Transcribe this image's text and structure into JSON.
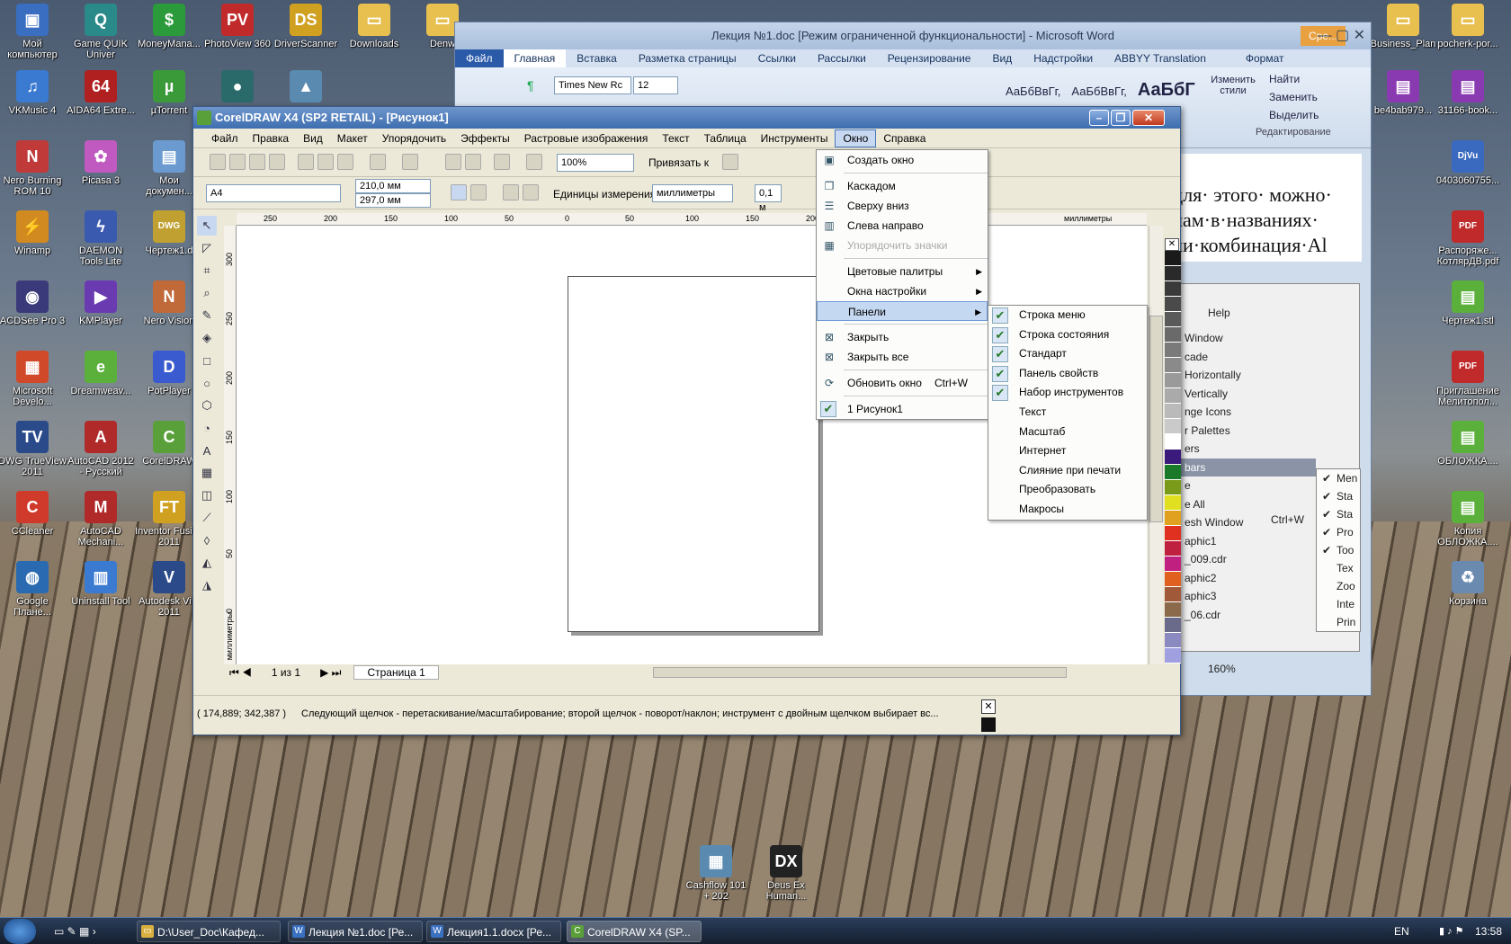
{
  "desktop_left": [
    {
      "label": "Мой компьютер",
      "icon": "computer-icon",
      "color": "#3a6ec0",
      "glyph": "▣"
    },
    {
      "label": "Game QUIK Univer",
      "icon": "quik-icon",
      "color": "#2a8a8a",
      "glyph": "Q"
    },
    {
      "label": "MoneyMana...",
      "icon": "money-icon",
      "color": "#2a9a3a",
      "glyph": "$"
    },
    {
      "label": "PhotoView 360",
      "icon": "photoview-icon",
      "color": "#c02a2a",
      "glyph": "PV"
    },
    {
      "label": "DriverScanner",
      "icon": "driver-icon",
      "color": "#d0a020",
      "glyph": "DS"
    },
    {
      "label": "Downloads",
      "icon": "folder-icon",
      "color": "#e8c050",
      "glyph": "▭"
    },
    {
      "label": "Denw",
      "icon": "folder-icon",
      "color": "#e8c050",
      "glyph": "▭"
    },
    {
      "label": "VKMusic 4",
      "icon": "vkmusic-icon",
      "color": "#3a7ad0",
      "glyph": "♫"
    },
    {
      "label": "AIDA64 Extre...",
      "icon": "aida-icon",
      "color": "#b02020",
      "glyph": "64"
    },
    {
      "label": "µTorrent",
      "icon": "torrent-icon",
      "color": "#3a9a3a",
      "glyph": "µ"
    },
    {
      "label": "",
      "icon": "app-icon",
      "color": "#2a6a6a",
      "glyph": "●"
    },
    {
      "label": "",
      "icon": "app-icon",
      "color": "#5a8ab0",
      "glyph": "▲"
    },
    {
      "label": "Nero Burning ROM 10",
      "icon": "nero-icon",
      "color": "#c03a3a",
      "glyph": "N"
    },
    {
      "label": "Picasa 3",
      "icon": "picasa-icon",
      "color": "#c05ac0",
      "glyph": "✿"
    },
    {
      "label": "Мои докумен...",
      "icon": "documents-icon",
      "color": "#6a9ad0",
      "glyph": "▤"
    },
    {
      "label": "Winamp",
      "icon": "winamp-icon",
      "color": "#d08a20",
      "glyph": "⚡"
    },
    {
      "label": "DAEMON Tools Lite",
      "icon": "daemon-icon",
      "color": "#3a5ab0",
      "glyph": "ϟ"
    },
    {
      "label": "Чертеж1.d",
      "icon": "dwg-icon",
      "color": "#c0a030",
      "glyph": "DWG"
    },
    {
      "label": "ACDSee Pro 3",
      "icon": "acdsee-icon",
      "color": "#3a3a7a",
      "glyph": "◉"
    },
    {
      "label": "KMPlayer",
      "icon": "kmplayer-icon",
      "color": "#6a3ab0",
      "glyph": "▶"
    },
    {
      "label": "Nero Vision",
      "icon": "nerovision-icon",
      "color": "#c06a3a",
      "glyph": "N"
    },
    {
      "label": "Microsoft Develo...",
      "icon": "msdev-icon",
      "color": "#d04a2a",
      "glyph": "▦"
    },
    {
      "label": "Dreamweav...",
      "icon": "dreamweaver-icon",
      "color": "#5ab03a",
      "glyph": "e"
    },
    {
      "label": "PotPlayer",
      "icon": "potplayer-icon",
      "color": "#3a5ad0",
      "glyph": "D"
    },
    {
      "label": "DWG TrueView 2011",
      "icon": "trueview-icon",
      "color": "#2a4a8a",
      "glyph": "TV"
    },
    {
      "label": "AutoCAD 2012 - Русский",
      "icon": "autocad-icon",
      "color": "#b02a2a",
      "glyph": "A"
    },
    {
      "label": "CorelDRAW",
      "icon": "coreldraw-icon",
      "color": "#5aa03a",
      "glyph": "C"
    },
    {
      "label": "CCleaner",
      "icon": "ccleaner-icon",
      "color": "#d03a2a",
      "glyph": "C"
    },
    {
      "label": "AutoCAD Mechani...",
      "icon": "autocad-mech-icon",
      "color": "#b02a2a",
      "glyph": "M"
    },
    {
      "label": "Inventor Fusion 2011",
      "icon": "inventor-icon",
      "color": "#d0a020",
      "glyph": "FT"
    },
    {
      "label": "Google Плане...",
      "icon": "google-earth-icon",
      "color": "#2a6ab0",
      "glyph": "◍"
    },
    {
      "label": "Uninstall Tool",
      "icon": "uninstall-icon",
      "color": "#3a7ad0",
      "glyph": "▥"
    },
    {
      "label": "Autodesk Vi... 2011",
      "icon": "autodesk-icon",
      "color": "#2a4a8a",
      "glyph": "V"
    }
  ],
  "desktop_right": [
    {
      "label": "Business_Plan",
      "icon": "folder-icon",
      "color": "#e8c050",
      "glyph": "▭"
    },
    {
      "label": "pocherk-por...",
      "icon": "folder-icon",
      "color": "#e8c050",
      "glyph": "▭"
    },
    {
      "label": "be4bab979...",
      "icon": "archive-icon",
      "color": "#8a3ab0",
      "glyph": "▤"
    },
    {
      "label": "31166-book...",
      "icon": "archive-icon",
      "color": "#8a3ab0",
      "glyph": "▤"
    },
    {
      "label": "0403060755...",
      "icon": "djvu-icon",
      "color": "#3a6ac0",
      "glyph": "DjVu"
    },
    {
      "label": "Распоряже... КотлярДВ.pdf",
      "icon": "pdf-icon",
      "color": "#c02a2a",
      "glyph": "PDF"
    },
    {
      "label": "Чертеж1.stl",
      "icon": "stl-icon",
      "color": "#5ab03a",
      "glyph": "▤"
    },
    {
      "label": "Приглашение Мелитопол...",
      "icon": "pdf-icon",
      "color": "#c02a2a",
      "glyph": "PDF"
    },
    {
      "label": "ОБЛОЖКА....",
      "icon": "doc-icon",
      "color": "#5ab03a",
      "glyph": "▤"
    },
    {
      "label": "Копия ОБЛОЖКА....",
      "icon": "doc-icon",
      "color": "#5ab03a",
      "glyph": "▤"
    },
    {
      "label": "Корзина",
      "icon": "recycle-bin-icon",
      "color": "#6a8ab0",
      "glyph": "♻"
    }
  ],
  "desktop_bottom": [
    {
      "label": "Cashflow 101 + 202",
      "icon": "cashflow-icon",
      "color": "#5a8ab0",
      "glyph": "▦"
    },
    {
      "label": "Deus Ex Human...",
      "icon": "deusex-icon",
      "color": "#222",
      "glyph": "DX"
    }
  ],
  "word": {
    "title": "Лекция №1.doc [Режим ограниченной функциональности] - Microsoft Word",
    "context_tab": "Сре...",
    "tabs": [
      "Файл",
      "Главная",
      "Вставка",
      "Разметка страницы",
      "Ссылки",
      "Рассылки",
      "Рецензирование",
      "Вид",
      "Надстройки",
      "ABBYY Translation",
      "Формат"
    ],
    "font": "Times New Rc",
    "size": "12",
    "styles": [
      "АаБбВвГг,",
      "АаБбВвГг,",
      "АаБбГ"
    ],
    "change_styles": "Изменить стили",
    "find": "Найти",
    "replace": "Заменить",
    "select": "Выделить",
    "editing": "Редактирование",
    "doc_lines": [
      "для· этого· можно· ",
      "лам·в·названиях· ",
      "ли·комбинация·Al"
    ]
  },
  "word_sub": {
    "help": "Help",
    "items": [
      "Window",
      "cade",
      "Horizontally",
      "Vertically",
      "nge Icons",
      "r Palettes",
      "ers",
      "bars",
      "e",
      "e All",
      "esh Window",
      "aphic1",
      "_009.cdr",
      "aphic2",
      "aphic3",
      "_06.cdr"
    ],
    "shortcut": "Ctrl+W",
    "sub2": [
      "Men",
      "Sta",
      "Sta",
      "Pro",
      "Too",
      "Tex",
      "Zoo",
      "Inte",
      "Prin"
    ],
    "zoom": "160%"
  },
  "corel": {
    "title": "CorelDRAW X4 (SP2 RETAIL) - [Рисунок1]",
    "menu": [
      "Файл",
      "Правка",
      "Вид",
      "Макет",
      "Упорядочить",
      "Эффекты",
      "Растровые изображения",
      "Текст",
      "Таблица",
      "Инструменты",
      "Окно",
      "Справка"
    ],
    "zoom": "100%",
    "snap": "Привязать к",
    "page_size": "A4",
    "width": "210,0 мм",
    "height": "297,0 мм",
    "units_label": "Единицы измерения:",
    "units": "миллиметры",
    "nudge": "0,1 м",
    "ruler_h": [
      "250",
      "200",
      "150",
      "100",
      "50",
      "0",
      "50",
      "100",
      "150",
      "200"
    ],
    "ruler_unit": "миллиметры",
    "ruler_v": [
      "300",
      "250",
      "200",
      "150",
      "100",
      "50",
      "0"
    ],
    "ruler_v_unit": "миллиметры",
    "page_nav": "1 из 1",
    "page_tab": "Страница 1",
    "coords": "( 174,889; 342,387 )",
    "status": "Следующий щелчок - перетаскивание/масштабирование; второй щелчок - поворот/наклон; инструмент с двойным щелчком выбирает вс...",
    "palette": [
      "#1a1a1a",
      "#2a2a2a",
      "#3a3a3a",
      "#4a4a4a",
      "#5a5a5a",
      "#6a6a6a",
      "#7a7a7a",
      "#8a8a8a",
      "#9a9a9a",
      "#aaaaaa",
      "#bababa",
      "#cacaca",
      "#ffffff",
      "#3a1a7a",
      "#1a7a2a",
      "#7a9a1a",
      "#e0e020",
      "#e0a020",
      "#e03020",
      "#c02040",
      "#c02080",
      "#e06020",
      "#a05a3a",
      "#8a6a4a",
      "#6a6a8a",
      "#8a8ac0",
      "#a0a0e0"
    ]
  },
  "window_menu": {
    "items": [
      {
        "label": "Создать окно",
        "icon": "new-window-icon"
      },
      {
        "sep": true
      },
      {
        "label": "Каскадом",
        "icon": "cascade-icon"
      },
      {
        "label": "Сверху вниз",
        "icon": "tile-horizontal-icon"
      },
      {
        "label": "Слева направо",
        "icon": "tile-vertical-icon"
      },
      {
        "label": "Упорядочить значки",
        "icon": "arrange-icons-icon",
        "disabled": true
      },
      {
        "sep": true
      },
      {
        "label": "Цветовые палитры",
        "arrow": true
      },
      {
        "label": "Окна настройки",
        "arrow": true
      },
      {
        "label": "Панели",
        "arrow": true,
        "selected": true
      },
      {
        "sep": true
      },
      {
        "label": "Закрыть",
        "icon": "close-window-icon"
      },
      {
        "label": "Закрыть все",
        "icon": "close-all-icon"
      },
      {
        "sep": true
      },
      {
        "label": "Обновить окно",
        "icon": "refresh-icon",
        "shortcut": "Ctrl+W"
      },
      {
        "sep": true
      },
      {
        "label": "1 Рисунок1",
        "check": true
      }
    ]
  },
  "panels_menu": {
    "items": [
      {
        "label": "Строка меню",
        "check": true
      },
      {
        "label": "Строка состояния",
        "check": true
      },
      {
        "label": "Стандарт",
        "check": true
      },
      {
        "label": "Панель свойств",
        "check": true
      },
      {
        "label": "Набор инструментов",
        "check": true
      },
      {
        "label": "Текст"
      },
      {
        "label": "Масштаб"
      },
      {
        "label": "Интернет"
      },
      {
        "label": "Слияние при печати"
      },
      {
        "label": "Преобразовать"
      },
      {
        "label": "Макросы"
      }
    ]
  },
  "taskbar": {
    "buttons": [
      {
        "label": "D:\\User_Doc\\Кафед...",
        "icon": "folder-icon"
      },
      {
        "label": "Лекция №1.doc [Ре...",
        "icon": "word-icon"
      },
      {
        "label": "Лекция1.1.docx [Ре...",
        "icon": "word-icon"
      },
      {
        "label": "CorelDRAW X4 (SP...",
        "icon": "coreldraw-icon",
        "active": true
      }
    ],
    "lang": "EN",
    "time": "13:58"
  }
}
